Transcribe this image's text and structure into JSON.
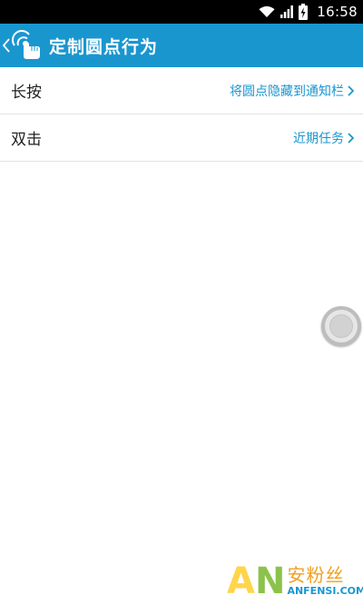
{
  "status_bar": {
    "time": "16:58",
    "icons": [
      "wifi-icon",
      "signal-icon",
      "battery-charging-icon"
    ]
  },
  "action_bar": {
    "title": "定制圆点行为",
    "icons": [
      "back-chevron-icon",
      "app-logo-icon"
    ]
  },
  "settings": {
    "rows": [
      {
        "label": "长按",
        "value": "将圆点隐藏到通知栏"
      },
      {
        "label": "双击",
        "value": "近期任务"
      }
    ]
  },
  "colors": {
    "accent": "#1a96cf",
    "status_bar_bg": "#000000",
    "divider": "#e2e2e2"
  },
  "floating_ball": {
    "icon": "floating-ball-icon"
  },
  "watermark": {
    "letters": "AN",
    "chinese": "安粉丝",
    "domain": "ANFENSI.COM"
  }
}
